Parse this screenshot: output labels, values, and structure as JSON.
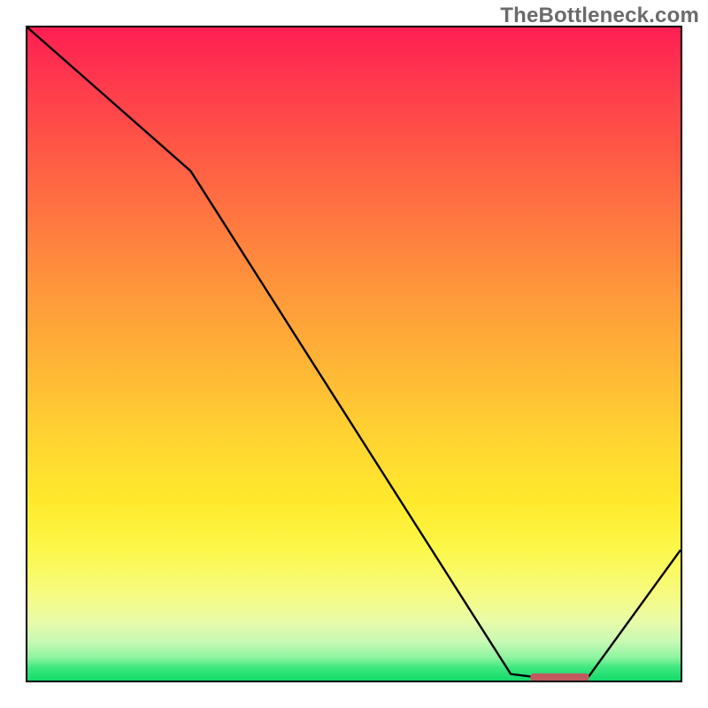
{
  "watermark": "TheBottleneck.com",
  "chart_data": {
    "type": "line",
    "title": "",
    "xlabel": "",
    "ylabel": "",
    "xlim": [
      0,
      100
    ],
    "ylim": [
      0,
      100
    ],
    "grid": false,
    "x": [
      0,
      25,
      74,
      78,
      86,
      100
    ],
    "values": [
      100,
      78,
      1,
      0.5,
      0.7,
      20
    ],
    "optimal_range": {
      "x_start": 77,
      "x_end": 86,
      "y": 0.5
    },
    "marker_color": "#c15a5f",
    "line_color": "#000000",
    "background_gradient": {
      "top": "#ff1f52",
      "mid": "#ffd431",
      "bottom": "#13db6a"
    }
  }
}
